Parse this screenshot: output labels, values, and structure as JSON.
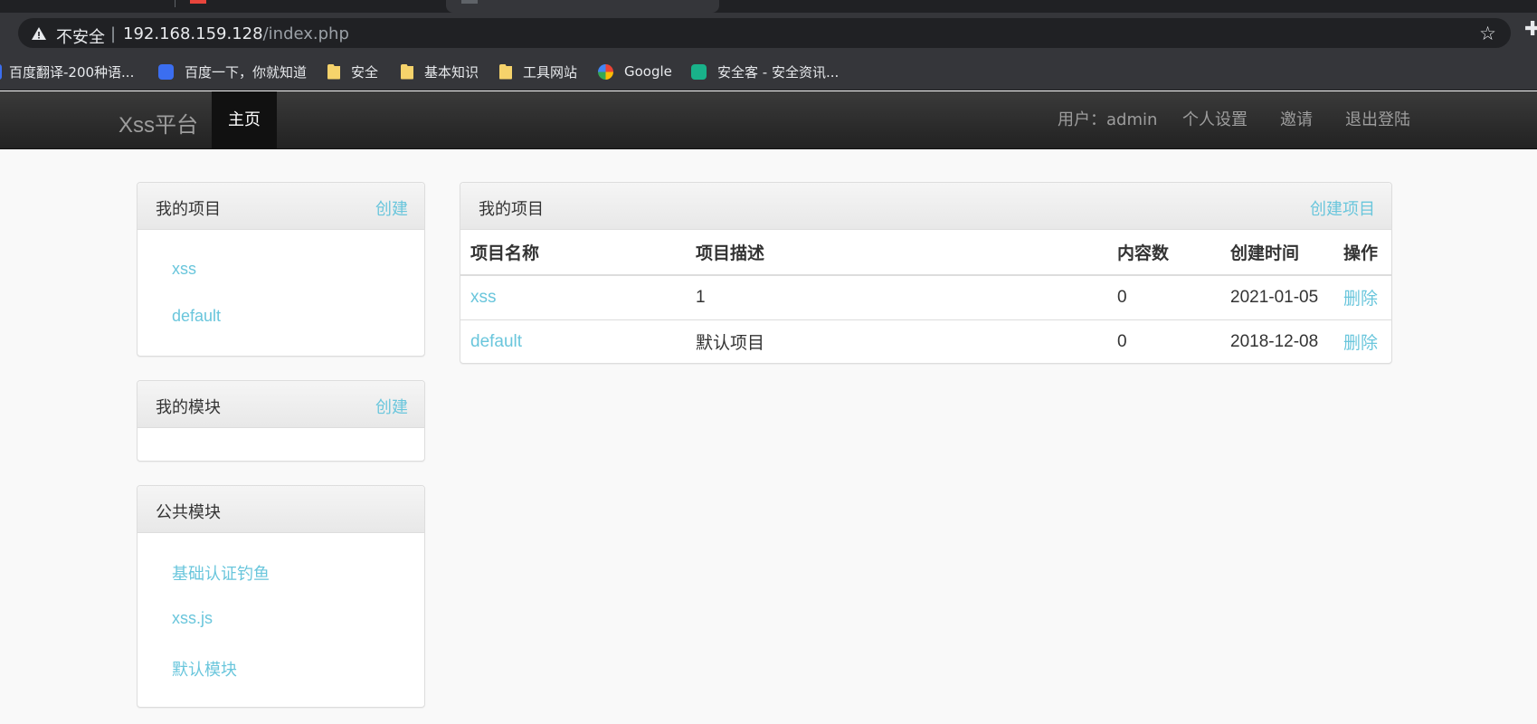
{
  "browser": {
    "not_secure": "不安全",
    "separator": "|",
    "url_host": "192.168.159.128",
    "url_path": "/index.php",
    "bookmarks": [
      {
        "label": "百度翻译-200种语...",
        "icon": "baidu-translate-icon"
      },
      {
        "label": "百度一下，你就知道",
        "icon": "baidu-icon"
      },
      {
        "label": "安全",
        "icon": "folder-icon"
      },
      {
        "label": "基本知识",
        "icon": "folder-icon"
      },
      {
        "label": "工具网站",
        "icon": "folder-icon"
      },
      {
        "label": "Google",
        "icon": "google-icon"
      },
      {
        "label": "安全客 - 安全资讯...",
        "icon": "anquanke-icon"
      }
    ]
  },
  "navbar": {
    "brand": "Xss平台",
    "home": "主页",
    "user": "用户：admin",
    "settings": "个人设置",
    "invite": "邀请",
    "logout": "退出登陆"
  },
  "sidebar": {
    "my_projects": {
      "title": "我的项目",
      "action": "创建",
      "items": [
        "xss",
        "default"
      ]
    },
    "my_modules": {
      "title": "我的模块",
      "action": "创建"
    },
    "public_modules": {
      "title": "公共模块",
      "items": [
        "基础认证钓鱼",
        "xss.js",
        "默认模块"
      ]
    }
  },
  "main": {
    "title": "我的项目",
    "action": "创建项目",
    "columns": [
      "项目名称",
      "项目描述",
      "内容数",
      "创建时间",
      "操作"
    ],
    "rows": [
      {
        "name": "xss",
        "desc": "1",
        "count": "0",
        "date": "2021-01-05",
        "op": "删除"
      },
      {
        "name": "default",
        "desc": "默认项目",
        "count": "0",
        "date": "2018-12-08",
        "op": "删除"
      }
    ]
  },
  "colors": {
    "link": "#6ac6dc",
    "navbar": "#222222"
  }
}
